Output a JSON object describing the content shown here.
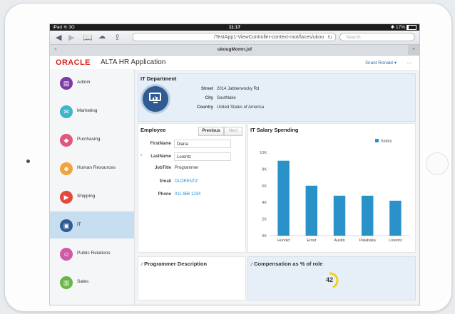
{
  "device": {
    "status": {
      "carrier": "iPad",
      "network": "3G",
      "time": "11:17",
      "battery": "17%"
    }
  },
  "browser": {
    "url": "/TestApp1-ViewController-context-root/faces/ukou",
    "search_placeholder": "Search",
    "tab_title": "ukougMomn.jsf"
  },
  "app": {
    "brand": "ORACLE",
    "title": "ALTA HR Application",
    "user": "Grant Ronald",
    "more": "...."
  },
  "nav": {
    "items": [
      {
        "label": "Admin",
        "icon": "admin-icon",
        "color": "#7b3aa5"
      },
      {
        "label": "Marketing",
        "icon": "mail-icon",
        "color": "#3fb5c8"
      },
      {
        "label": "Purchasing",
        "icon": "tag-icon",
        "color": "#e2577c"
      },
      {
        "label": "Human Resources",
        "icon": "people-icon",
        "color": "#f2a33c"
      },
      {
        "label": "Shipping",
        "icon": "truck-icon",
        "color": "#e04a3f"
      },
      {
        "label": "IT",
        "icon": "monitor-icon",
        "color": "#2f5b92"
      },
      {
        "label": "Public Relations",
        "icon": "group-icon",
        "color": "#d05aa6"
      },
      {
        "label": "Sales",
        "icon": "chart-icon",
        "color": "#6ab543"
      }
    ],
    "selected": "IT"
  },
  "department": {
    "title": "IT Department",
    "street_label": "Street",
    "street": "2014 Jabberwocky Rd",
    "city_label": "City",
    "city": "Southlake",
    "country_label": "Country",
    "country": "United States of America"
  },
  "employee": {
    "title": "Employee",
    "previous_label": "Previous",
    "next_label": "Next",
    "first_name_label": "FirstName",
    "first_name": "Diana",
    "required_mark": "*",
    "last_name_label": "LastName",
    "last_name": "Lorentz",
    "job_title_label": "JobTitle",
    "job_title": "Programmer",
    "email_label": "Email",
    "email": "DLORENTZ",
    "phone_label": "Phone",
    "phone": "011 666 1234"
  },
  "salary_panel": {
    "title": "IT Salary Spending"
  },
  "chart_data": {
    "type": "bar",
    "categories": [
      "Hunold",
      "Ernst",
      "Austin",
      "Pataballa",
      "Lorentz"
    ],
    "series": [
      {
        "name": "Salary",
        "values": [
          9000,
          6000,
          4800,
          4800,
          4200
        ],
        "color": "#2b91c9"
      }
    ],
    "yticks": [
      "0K",
      "2K",
      "4K",
      "6K",
      "8K",
      "10K"
    ],
    "ylim": [
      0,
      10000
    ],
    "legend": "top-right",
    "grid": false
  },
  "description_panel": {
    "title": "Programmer Description"
  },
  "compensation_panel": {
    "title": "Compensation as % of role",
    "value": "42",
    "fraction": 0.42
  }
}
